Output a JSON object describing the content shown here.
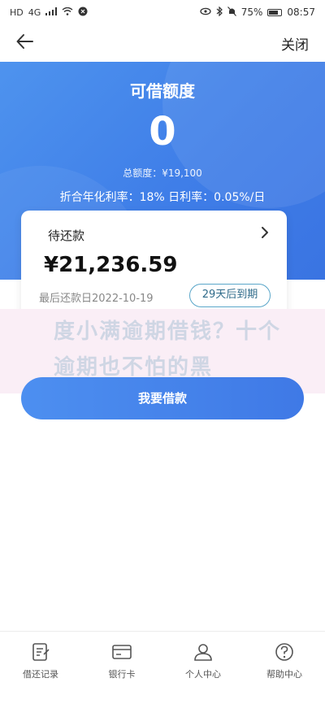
{
  "status_bar": {
    "left_icons": [
      "HD",
      "4G",
      "signal-icon",
      "wifi-icon",
      "nfc-icon"
    ],
    "battery_level": "75%",
    "time": "08:57"
  },
  "nav": {
    "close_label": "关闭"
  },
  "hero": {
    "title": "可借额度",
    "amount": "0",
    "total_quota": "总额度：¥19,100",
    "rate_text": "折合年化利率：18%  日利率：0.05%/日"
  },
  "repay_card": {
    "title": "待还款",
    "amount": "¥21,236.59",
    "last_date": "最后还款日2022-10-19",
    "due_badge": "29天后到期"
  },
  "watermark": {
    "text": "度小满逾期借钱？十个逾期也不怕的黑"
  },
  "borrow_button": {
    "label": "我要借款"
  },
  "tabs": [
    {
      "label": "借还记录",
      "icon": "record-icon"
    },
    {
      "label": "银行卡",
      "icon": "bank-card-icon"
    },
    {
      "label": "个人中心",
      "icon": "person-icon"
    },
    {
      "label": "帮助中心",
      "icon": "help-icon"
    }
  ],
  "colors": {
    "primary_blue": "#3f7ee8",
    "badge_border": "#5aa6c9"
  }
}
